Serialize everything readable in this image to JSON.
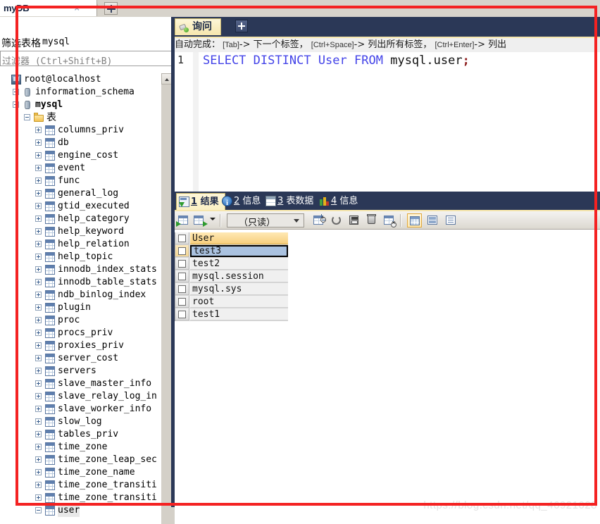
{
  "window": {
    "main_tab": {
      "label": "myDB",
      "close": "×"
    },
    "add_tab": "+"
  },
  "sidebar": {
    "filter_title_cjk": "筛选表格",
    "filter_title_db": "mysql",
    "filter_input_placeholder": "过滤器 (Ctrl+Shift+B)",
    "filter_input_value": "",
    "tree": [
      {
        "label": "root@localhost",
        "indent": 0,
        "icon": "connection-icon",
        "expander": "none",
        "bold": false
      },
      {
        "label": "information_schema",
        "indent": 1,
        "icon": "database-icon",
        "expander": "plus",
        "bold": false
      },
      {
        "label": "mysql",
        "indent": 1,
        "icon": "database-icon",
        "expander": "plus",
        "bold": true
      },
      {
        "label": "表",
        "indent": 2,
        "icon": "folder-icon",
        "expander": "minus",
        "bold": false,
        "cjk": true
      },
      {
        "label": "columns_priv",
        "indent": 3,
        "icon": "table-icon",
        "expander": "plus",
        "bold": false
      },
      {
        "label": "db",
        "indent": 3,
        "icon": "table-icon",
        "expander": "plus",
        "bold": false
      },
      {
        "label": "engine_cost",
        "indent": 3,
        "icon": "table-icon",
        "expander": "plus",
        "bold": false
      },
      {
        "label": "event",
        "indent": 3,
        "icon": "table-icon",
        "expander": "plus",
        "bold": false
      },
      {
        "label": "func",
        "indent": 3,
        "icon": "table-icon",
        "expander": "plus",
        "bold": false
      },
      {
        "label": "general_log",
        "indent": 3,
        "icon": "table-icon",
        "expander": "plus",
        "bold": false
      },
      {
        "label": "gtid_executed",
        "indent": 3,
        "icon": "table-icon",
        "expander": "plus",
        "bold": false
      },
      {
        "label": "help_category",
        "indent": 3,
        "icon": "table-icon",
        "expander": "plus",
        "bold": false
      },
      {
        "label": "help_keyword",
        "indent": 3,
        "icon": "table-icon",
        "expander": "plus",
        "bold": false
      },
      {
        "label": "help_relation",
        "indent": 3,
        "icon": "table-icon",
        "expander": "plus",
        "bold": false
      },
      {
        "label": "help_topic",
        "indent": 3,
        "icon": "table-icon",
        "expander": "plus",
        "bold": false
      },
      {
        "label": "innodb_index_stats",
        "indent": 3,
        "icon": "table-icon",
        "expander": "plus",
        "bold": false
      },
      {
        "label": "innodb_table_stats",
        "indent": 3,
        "icon": "table-icon",
        "expander": "plus",
        "bold": false
      },
      {
        "label": "ndb_binlog_index",
        "indent": 3,
        "icon": "table-icon",
        "expander": "plus",
        "bold": false
      },
      {
        "label": "plugin",
        "indent": 3,
        "icon": "table-icon",
        "expander": "plus",
        "bold": false
      },
      {
        "label": "proc",
        "indent": 3,
        "icon": "table-icon",
        "expander": "plus",
        "bold": false
      },
      {
        "label": "procs_priv",
        "indent": 3,
        "icon": "table-icon",
        "expander": "plus",
        "bold": false
      },
      {
        "label": "proxies_priv",
        "indent": 3,
        "icon": "table-icon",
        "expander": "plus",
        "bold": false
      },
      {
        "label": "server_cost",
        "indent": 3,
        "icon": "table-icon",
        "expander": "plus",
        "bold": false
      },
      {
        "label": "servers",
        "indent": 3,
        "icon": "table-icon",
        "expander": "plus",
        "bold": false
      },
      {
        "label": "slave_master_info",
        "indent": 3,
        "icon": "table-icon",
        "expander": "plus",
        "bold": false
      },
      {
        "label": "slave_relay_log_in",
        "indent": 3,
        "icon": "table-icon",
        "expander": "plus",
        "bold": false
      },
      {
        "label": "slave_worker_info",
        "indent": 3,
        "icon": "table-icon",
        "expander": "plus",
        "bold": false
      },
      {
        "label": "slow_log",
        "indent": 3,
        "icon": "table-icon",
        "expander": "plus",
        "bold": false
      },
      {
        "label": "tables_priv",
        "indent": 3,
        "icon": "table-icon",
        "expander": "plus",
        "bold": false
      },
      {
        "label": "time_zone",
        "indent": 3,
        "icon": "table-icon",
        "expander": "plus",
        "bold": false
      },
      {
        "label": "time_zone_leap_sec",
        "indent": 3,
        "icon": "table-icon",
        "expander": "plus",
        "bold": false
      },
      {
        "label": "time_zone_name",
        "indent": 3,
        "icon": "table-icon",
        "expander": "plus",
        "bold": false
      },
      {
        "label": "time_zone_transiti",
        "indent": 3,
        "icon": "table-icon",
        "expander": "plus",
        "bold": false
      },
      {
        "label": "time_zone_transiti",
        "indent": 3,
        "icon": "table-icon",
        "expander": "plus",
        "bold": false
      },
      {
        "label": "user",
        "indent": 3,
        "icon": "table-icon",
        "expander": "minus",
        "bold": false,
        "selected": true
      }
    ]
  },
  "query": {
    "tab_label": "询问",
    "add_tab": "+",
    "hint_prefix": "自动完成：",
    "hint_parts": [
      {
        "key": "[Tab]",
        "arrow": "-> ",
        "text": "下一个标签，"
      },
      {
        "key": "[Ctrl+Space]",
        "arrow": "-> ",
        "text": "列出所有标签，"
      },
      {
        "key": "[Ctrl+Enter]",
        "arrow": "-> ",
        "text": "列出"
      }
    ],
    "line_number": "1",
    "sql_tokens": [
      {
        "t": "SELECT",
        "k": "kw"
      },
      {
        "t": " ",
        "k": "pl"
      },
      {
        "t": "DISTINCT",
        "k": "kw"
      },
      {
        "t": " ",
        "k": "pl"
      },
      {
        "t": "User",
        "k": "kw"
      },
      {
        "t": " ",
        "k": "pl"
      },
      {
        "t": "FROM",
        "k": "kw"
      },
      {
        "t": " ",
        "k": "pl"
      },
      {
        "t": "mysql.user",
        "k": "pl"
      },
      {
        "t": ";",
        "k": "semi"
      }
    ],
    "sql_plain": "SELECT DISTINCT User FROM mysql.user;"
  },
  "results": {
    "tabs": [
      {
        "num": "1",
        "label": "结果",
        "icon": "result-grid-icon",
        "active": true
      },
      {
        "num": "2",
        "label": "信息",
        "icon": "info-icon",
        "active": false
      },
      {
        "num": "3",
        "label": "表数据",
        "icon": "table-data-icon",
        "active": false
      },
      {
        "num": "4",
        "label": "信息",
        "icon": "profile-chart-icon",
        "active": false
      }
    ],
    "toolbar": {
      "mode_select_value": "（只读）",
      "buttons": [
        {
          "name": "import-wizard-button"
        },
        {
          "name": "export-wizard-button"
        },
        {
          "name": "export-dropdown-caret"
        },
        {
          "name": "add-record-button"
        },
        {
          "name": "refresh-record-button"
        },
        {
          "name": "apply-changes-button"
        },
        {
          "name": "delete-record-button"
        },
        {
          "name": "discard-changes-button"
        },
        {
          "name": "grid-view-button"
        },
        {
          "name": "form-view-button"
        },
        {
          "name": "memo-view-button"
        }
      ]
    },
    "grid": {
      "column": "User",
      "rows": [
        {
          "value": "test3",
          "selected": true
        },
        {
          "value": "test2",
          "selected": false
        },
        {
          "value": "mysql.session",
          "selected": false
        },
        {
          "value": "mysql.sys",
          "selected": false
        },
        {
          "value": "root",
          "selected": false
        },
        {
          "value": "test1",
          "selected": false
        }
      ]
    }
  },
  "watermark": "https://blog.csdn.net/qq_46921028",
  "colors": {
    "accent_dark": "#2b3857",
    "active_tab": "#f6e6ad",
    "annotation": "#f42222",
    "selection": "#aac2e0",
    "header": "#f7cf7e"
  }
}
